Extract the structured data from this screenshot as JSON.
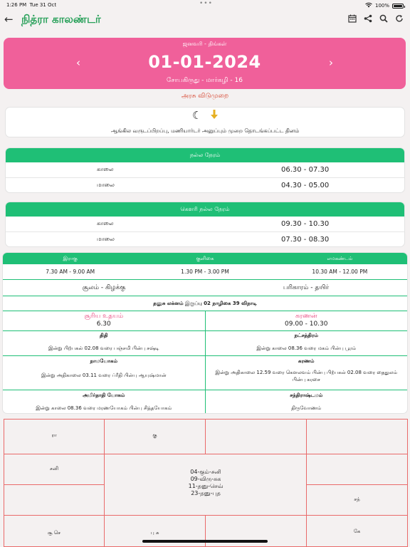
{
  "status": {
    "time": "1:26 PM",
    "date": "Tue 31 Oct",
    "battery": "100%"
  },
  "app": {
    "title": "நித்ரா காலண்டர்"
  },
  "header": {
    "month": "ஜனவரி - திங்கள்",
    "date": "01-01-2024",
    "tamil_date": "சோபகிருது - மார்கழி - 16"
  },
  "holiday": "அரசு விடுமுறை",
  "event": {
    "text": "ஆங்கில வருடப்பிறப்பு, மணியார்டர் அனுப்பும் முறை தொடங்கப்பட்ட தினம்"
  },
  "nalla_neram": {
    "title": "நல்ல நேரம்",
    "rows": [
      {
        "label": "காலை",
        "value": "06.30 - 07.30"
      },
      {
        "label": "மாலை",
        "value": "04.30 - 05.00"
      }
    ]
  },
  "gowri": {
    "title": "கௌரி நல்ல நேரம்",
    "rows": [
      {
        "label": "காலை",
        "value": "09.30 - 10.30"
      },
      {
        "label": "மாலை",
        "value": "07.30 - 08.30"
      }
    ]
  },
  "rahu": {
    "headers": [
      "இராகு",
      "குளிகை",
      "எமகண்டம்"
    ],
    "values": [
      "7.30 AM - 9.00 AM",
      "1.30 PM - 3.00 PM",
      "10.30 AM - 12.00 PM"
    ],
    "soolam": "சூலம் - கிழக்கு",
    "pariharam": "பரிகாரம் - தயிர்",
    "lagnam": "தனுசு லக்னம் இருப்பு 02 நாழிகை 39 விநாடி",
    "sunrise_label": "சூரிய உதயம்",
    "sunrise": "6.30",
    "karanan_label": "கரணன்",
    "karanan": "09.00 - 10.30",
    "thithi_label": "திதி",
    "thithi": "இன்று பிற்பகல் 02.08 வரை பஞ்சமி பின்பு சஷ்டி",
    "nakshatra_label": "நட்சத்திரம்",
    "nakshatra": "இன்று காலை 08.36 வரை மகம் பின்பு பூரம்",
    "yogam_label": "நாமயோகம்",
    "yogam": "இன்று அதிகாலை 03.11 வரை ப்ரீதி பின்பு ஆயுஷ்மான்",
    "karanam_label": "கரணம்",
    "karanam": "இன்று அதிகாலை 12.59 வரை கௌலவம் பின்பு பிற்பகல் 02.08 வரை தைதுலம் பின்பு கரசை",
    "amirtha_label": "அமிர்தாதி யோகம்",
    "amirtha": "இன்று காலை 08.36 வரை மரணயோகம் பின்பு சித்தயோகம்",
    "chandra_label": "சந்திராஷ்டமம்",
    "chandra": "திருவோணம்"
  },
  "rasi": {
    "ra": "ரா",
    "gu": "கு",
    "sani": "சனி",
    "san": "சந்",
    "su_se": "சூ செ",
    "bu_su": "பு சு",
    "ke": "கே",
    "center": [
      "04-கும்-சனி",
      "09-விரு-சுக",
      "11-தனு-செவ்",
      "23-தனு-புத"
    ]
  }
}
